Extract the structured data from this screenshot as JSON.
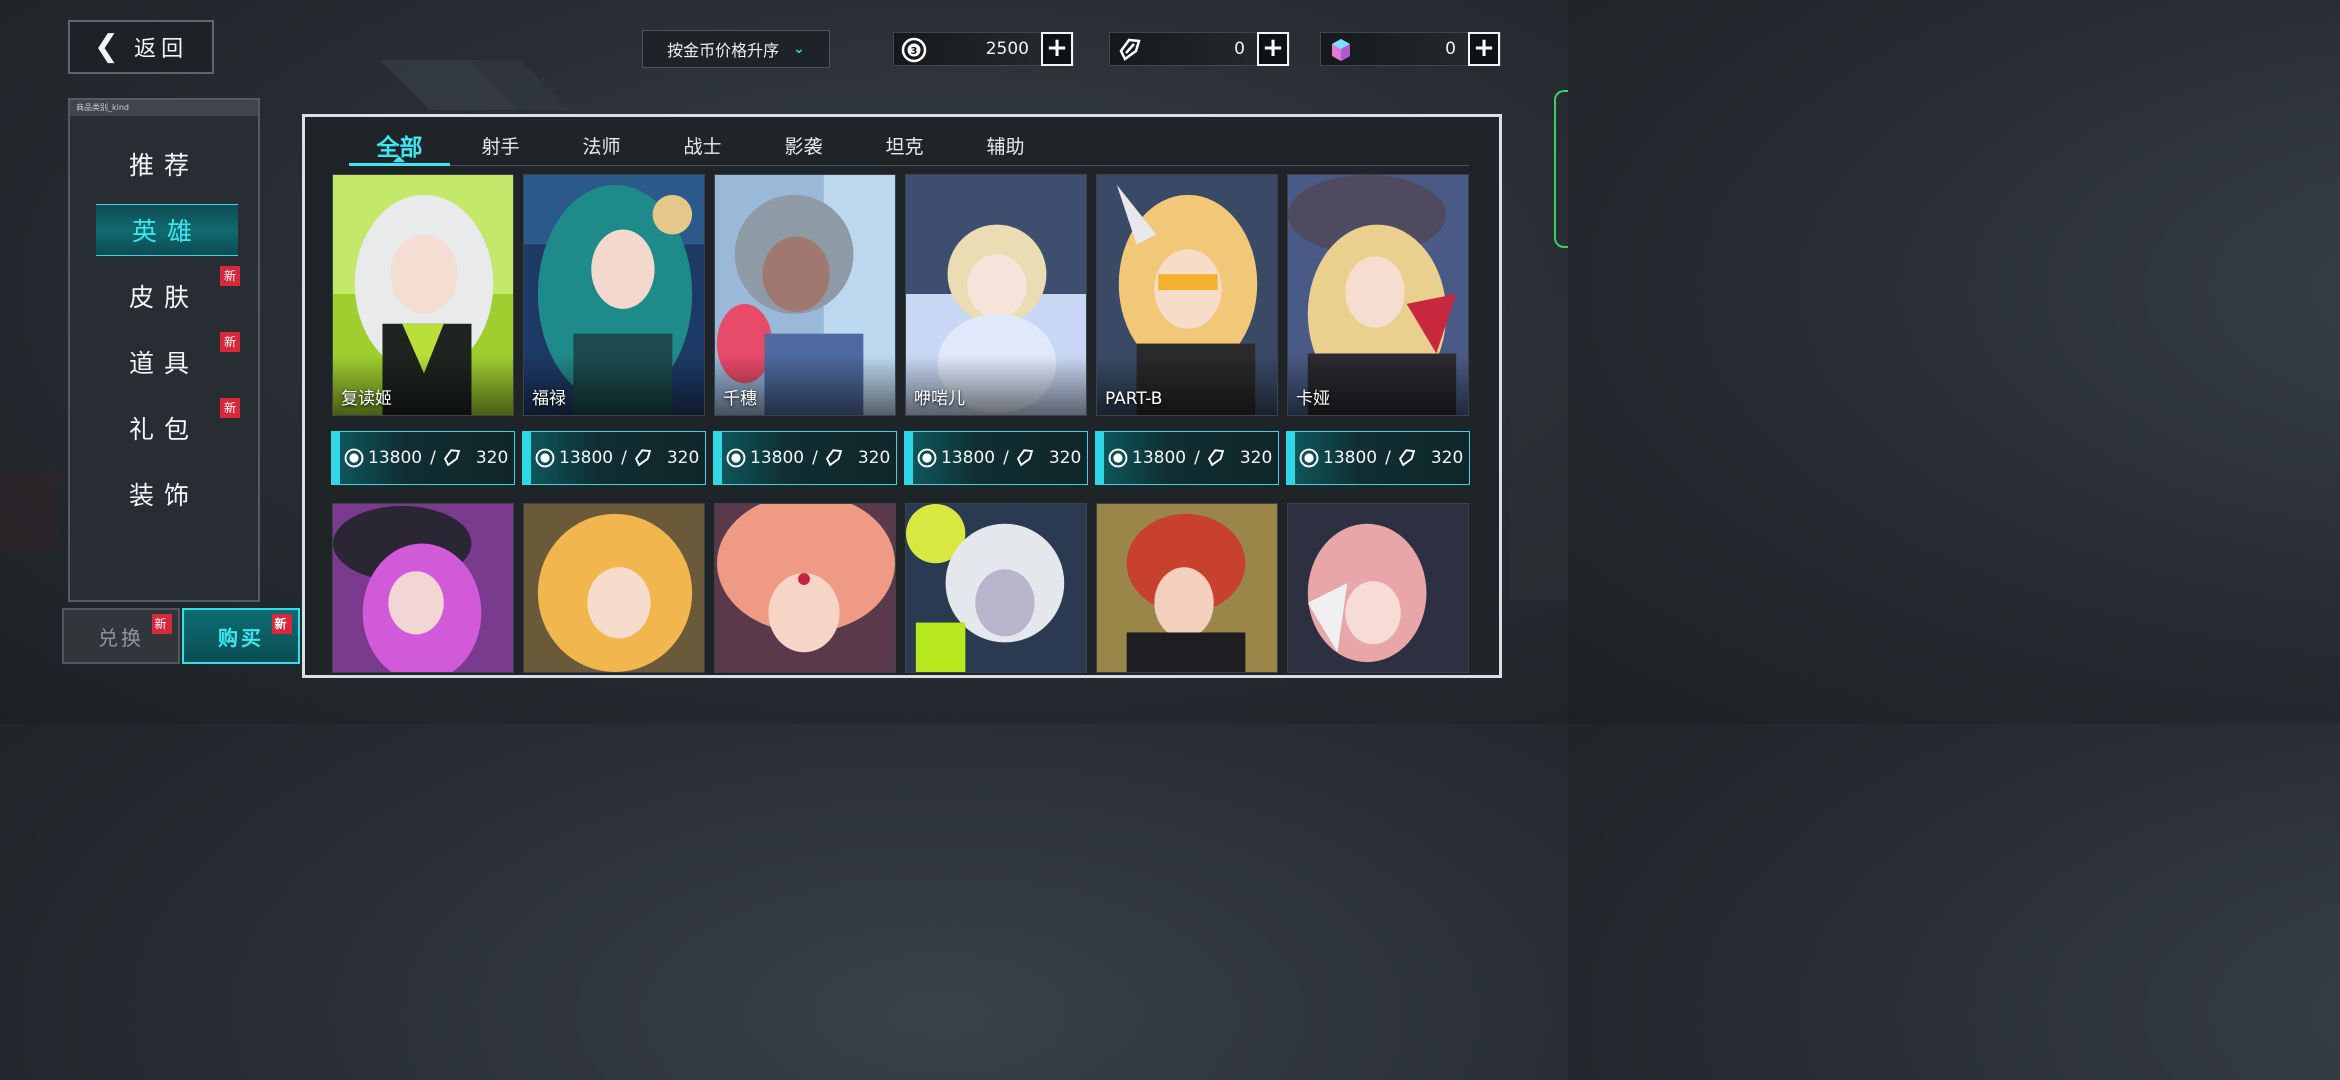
{
  "header": {
    "back_label": "返回",
    "sort_label": "按金币价格升序"
  },
  "currencies": [
    {
      "icon": "gold-coin-icon",
      "value": "2500"
    },
    {
      "icon": "crystal-voucher-icon",
      "value": "0"
    },
    {
      "icon": "gem-icon",
      "value": "0"
    }
  ],
  "sidebar": {
    "kind_label": "商品类别_kind",
    "items": [
      {
        "label": "推荐",
        "new": false
      },
      {
        "label": "英雄",
        "new": false,
        "active": true
      },
      {
        "label": "皮肤",
        "new": true
      },
      {
        "label": "道具",
        "new": true
      },
      {
        "label": "礼包",
        "new": true
      },
      {
        "label": "装饰",
        "new": false
      }
    ],
    "new_badge": "新",
    "exchange_label": "兑换",
    "buy_label": "购买"
  },
  "tabs": [
    "全部",
    "射手",
    "法师",
    "战士",
    "影袭",
    "坦克",
    "辅助"
  ],
  "heroes_row1": [
    {
      "name": "复读姬",
      "gold": "13800",
      "voucher": "320"
    },
    {
      "name": "福禄",
      "gold": "13800",
      "voucher": "320"
    },
    {
      "name": "千穗",
      "gold": "13800",
      "voucher": "320"
    },
    {
      "name": "咿啱儿",
      "gold": "13800",
      "voucher": "320"
    },
    {
      "name": "PART-B",
      "gold": "13800",
      "voucher": "320"
    },
    {
      "name": "卡娅",
      "gold": "13800",
      "voucher": "320"
    }
  ],
  "price_sep": "/",
  "colors": {
    "accent": "#3fe6f0",
    "badge": "#d8283b",
    "panel": "#1f2428"
  }
}
